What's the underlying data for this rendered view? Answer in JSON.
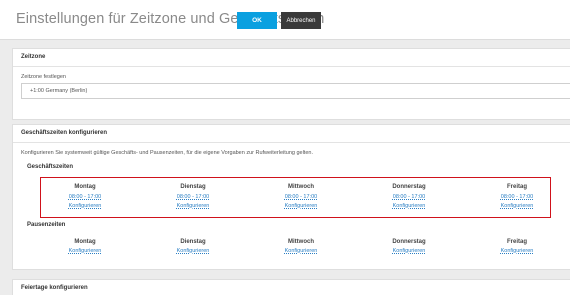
{
  "header": {
    "title": "Einstellungen für Zeitzone und Geschäftszeiten",
    "ok_label": "OK",
    "cancel_label": "Abbrechen"
  },
  "zeitzone": {
    "heading": "Zeitzone",
    "label": "Zeitzone festlegen",
    "value": "+1:00 Germany (Berlin)"
  },
  "geschaeftszeiten": {
    "heading": "Geschäftszeiten konfigurieren",
    "description": "Konfigurieren Sie systemweit gültige Geschäfts- und Pausenzeiten, für die eigene Vorgaben zur Rufweiterleitung gelten.",
    "business_hours": {
      "heading": "Geschäftszeiten",
      "days": [
        {
          "name": "Montag",
          "time": "08:00 - 17:00",
          "config": "Konfigurieren"
        },
        {
          "name": "Dienstag",
          "time": "08:00 - 17:00",
          "config": "Konfigurieren"
        },
        {
          "name": "Mittwoch",
          "time": "08:00 - 17:00",
          "config": "Konfigurieren"
        },
        {
          "name": "Donnerstag",
          "time": "08:00 - 17:00",
          "config": "Konfigurieren"
        },
        {
          "name": "Freitag",
          "time": "08:00 - 17:00",
          "config": "Konfigurieren"
        }
      ]
    },
    "break_times": {
      "heading": "Pausenzeiten",
      "days": [
        {
          "name": "Montag",
          "config": "Konfigurieren"
        },
        {
          "name": "Dienstag",
          "config": "Konfigurieren"
        },
        {
          "name": "Mittwoch",
          "config": "Konfigurieren"
        },
        {
          "name": "Donnerstag",
          "config": "Konfigurieren"
        },
        {
          "name": "Freitag",
          "config": "Konfigurieren"
        }
      ]
    }
  },
  "feiertage": {
    "heading": "Feiertage konfigurieren"
  },
  "colors": {
    "primary": "#0aa0e0",
    "cancel": "#3a3a3a",
    "link": "#2a7fc4",
    "highlight": "#d0121b"
  }
}
